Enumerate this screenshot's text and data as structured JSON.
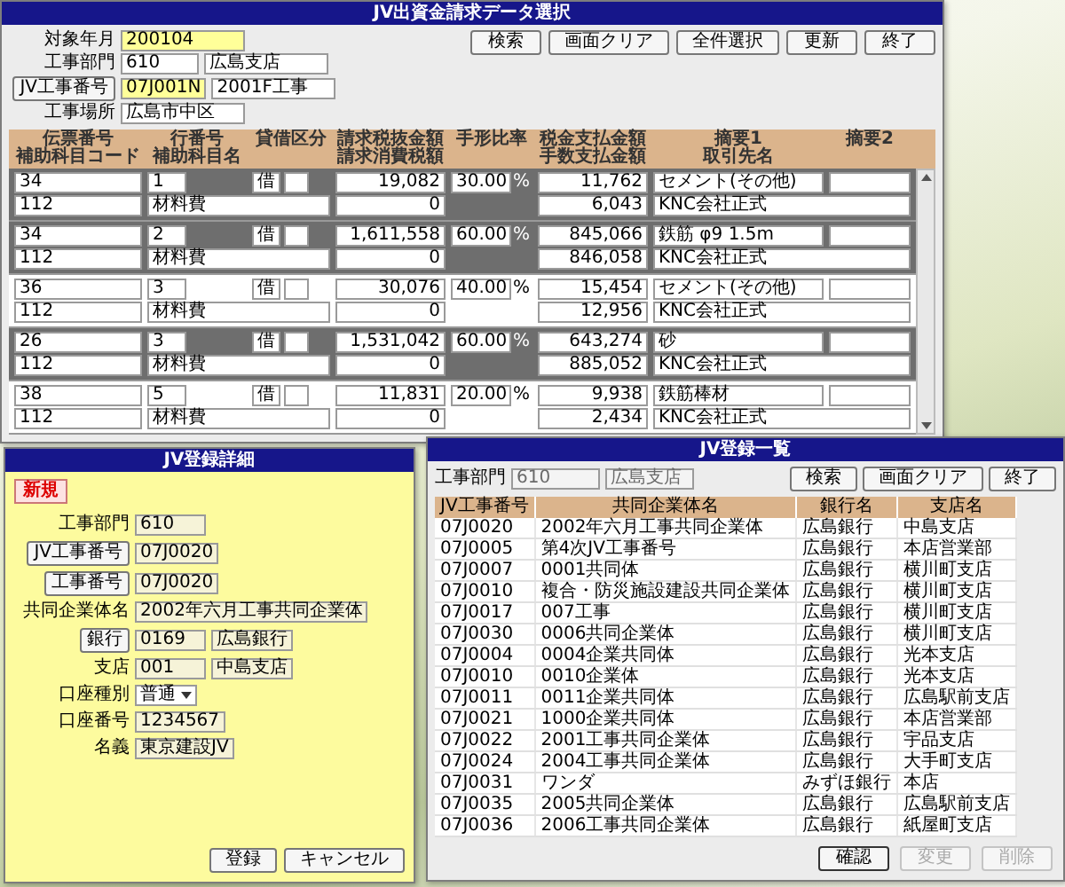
{
  "select_window": {
    "title": "JV出資金請求データ選択",
    "form": [
      {
        "label": "対象年月",
        "kind": "text",
        "fields": [
          {
            "value": "200104",
            "highlighted": true
          }
        ]
      },
      {
        "label": "工事部門",
        "kind": "text",
        "fields": [
          {
            "value": "610",
            "highlighted": false
          },
          {
            "value": "広島支店",
            "highlighted": false
          }
        ]
      },
      {
        "label": "JV工事番号",
        "kind": "button",
        "fields": [
          {
            "value": "07J001N",
            "highlighted": true
          },
          {
            "value": "2001F工事",
            "highlighted": false
          }
        ]
      },
      {
        "label": "工事場所",
        "kind": "text",
        "fields": [
          {
            "value": "広島市中区",
            "highlighted": false
          }
        ]
      }
    ],
    "buttons": [
      "検索",
      "画面クリア",
      "全件選択",
      "更新",
      "終了"
    ],
    "columns": [
      [
        "伝票番号",
        "補助科目コード"
      ],
      [
        "行番号",
        "補助科目名"
      ],
      [
        "貸借区分"
      ],
      [
        "請求税抜金額",
        "請求消費税額"
      ],
      [
        "手形比率"
      ],
      [
        "税金支払金額",
        "手数支払金額"
      ],
      [
        "摘要1",
        "取引先名"
      ],
      [
        "摘要2"
      ]
    ],
    "records": [
      {
        "selected": true,
        "slip": "34",
        "line": "1",
        "dc": "借",
        "amount": "19,082",
        "ratio": "30.00",
        "unit": "%",
        "payment": "11,762",
        "memo_1": "セメント(その他)",
        "sub_code": "112",
        "sub_name": "材料費",
        "tax": "0",
        "fee": "6,043",
        "partner": "KNC会社正式"
      },
      {
        "selected": true,
        "slip": "34",
        "line": "2",
        "dc": "借",
        "amount": "1,611,558",
        "ratio": "60.00",
        "unit": "%",
        "payment": "845,066",
        "memo_1": "鉄筋 φ9 1.5m",
        "sub_code": "112",
        "sub_name": "材料費",
        "tax": "0",
        "fee": "846,058",
        "partner": "KNC会社正式"
      },
      {
        "selected": false,
        "slip": "36",
        "line": "3",
        "dc": "借",
        "amount": "30,076",
        "ratio": "40.00",
        "unit": "%",
        "payment": "15,454",
        "memo_1": "セメント(その他)",
        "sub_code": "112",
        "sub_name": "材料費",
        "tax": "0",
        "fee": "12,956",
        "partner": "KNC会社正式"
      },
      {
        "selected": true,
        "slip": "26",
        "line": "3",
        "dc": "借",
        "amount": "1,531,042",
        "ratio": "60.00",
        "unit": "%",
        "payment": "643,274",
        "memo_1": "砂",
        "sub_code": "112",
        "sub_name": "材料費",
        "tax": "0",
        "fee": "885,052",
        "partner": "KNC会社正式"
      },
      {
        "selected": false,
        "slip": "38",
        "line": "5",
        "dc": "借",
        "amount": "11,831",
        "ratio": "20.00",
        "unit": "%",
        "payment": "9,938",
        "memo_1": "鉄筋棒材",
        "sub_code": "112",
        "sub_name": "材料費",
        "tax": "0",
        "fee": "2,434",
        "partner": "KNC会社正式"
      }
    ]
  },
  "list_window": {
    "title": "JV登録一覧",
    "filter": {
      "label": "工事部門",
      "disabled": true,
      "fields": [
        "610",
        "広島支店"
      ]
    },
    "buttons": [
      "検索",
      "画面クリア",
      "終了"
    ],
    "columns": [
      "JV工事番号",
      "共同企業体名",
      "銀行名",
      "支店名"
    ],
    "rows": [
      {
        "jv_number": "07J0020",
        "name": "2002年六月工事共同企業体",
        "bank": "広島銀行",
        "branch": "中島支店"
      },
      {
        "jv_number": "07J0005",
        "name": "第4次JV工事番号",
        "bank": "広島銀行",
        "branch": "本店営業部"
      },
      {
        "jv_number": "07J0007",
        "name": "0001共同体",
        "bank": "広島銀行",
        "branch": "横川町支店"
      },
      {
        "jv_number": "07J0010",
        "name": "複合・防災施設建設共同企業体",
        "bank": "広島銀行",
        "branch": "横川町支店"
      },
      {
        "jv_number": "07J0017",
        "name": "007工事",
        "bank": "広島銀行",
        "branch": "横川町支店"
      },
      {
        "jv_number": "07J0030",
        "name": "0006共同企業体",
        "bank": "広島銀行",
        "branch": "横川町支店"
      },
      {
        "jv_number": "07J0004",
        "name": "0004企業共同体",
        "bank": "広島銀行",
        "branch": "光本支店"
      },
      {
        "jv_number": "07J0010",
        "name": "0010企業体",
        "bank": "広島銀行",
        "branch": "光本支店"
      },
      {
        "jv_number": "07J0011",
        "name": "0011企業共同体",
        "bank": "広島銀行",
        "branch": "広島駅前支店"
      },
      {
        "jv_number": "07J0021",
        "name": "1000企業共同体",
        "bank": "広島銀行",
        "branch": "本店営業部"
      },
      {
        "jv_number": "07J0022",
        "name": "2001工事共同企業体",
        "bank": "広島銀行",
        "branch": "宇品支店"
      },
      {
        "jv_number": "07J0024",
        "name": "2004工事共同企業体",
        "bank": "広島銀行",
        "branch": "大手町支店"
      },
      {
        "jv_number": "07J0031",
        "name": "ワンダ",
        "bank": "みずほ銀行",
        "branch": "本店"
      },
      {
        "jv_number": "07J0035",
        "name": "2005共同企業体",
        "bank": "広島銀行",
        "branch": "広島駅前支店"
      },
      {
        "jv_number": "07J0036",
        "name": "2006工事共同企業体",
        "bank": "広島銀行",
        "branch": "紙屋町支店"
      }
    ],
    "footer_buttons": [
      {
        "label": "確認",
        "disabled": false
      },
      {
        "label": "変更",
        "disabled": true
      },
      {
        "label": "削除",
        "disabled": true
      }
    ]
  },
  "detail_window": {
    "title": "JV登録詳細",
    "mode_badge": "新規",
    "rows": [
      {
        "label": "工事部門",
        "kind": "text",
        "fields": [
          "610"
        ]
      },
      {
        "label": "JV工事番号",
        "kind": "button",
        "fields": [
          "07J0020"
        ]
      },
      {
        "label": "工事番号",
        "kind": "button",
        "fields": [
          "07J0020"
        ]
      },
      {
        "label": "共同企業体名",
        "kind": "text",
        "fields": [
          "2002年六月工事共同企業体"
        ]
      },
      {
        "label": "銀行",
        "kind": "button",
        "fields": [
          "0169",
          "広島銀行"
        ]
      },
      {
        "label": "支店",
        "kind": "text",
        "fields": [
          "001",
          "中島支店"
        ]
      },
      {
        "label": "口座種別",
        "kind": "select",
        "fields": [
          "普通"
        ]
      },
      {
        "label": "口座番号",
        "kind": "text",
        "fields": [
          "1234567"
        ]
      },
      {
        "label": "名義",
        "kind": "text",
        "fields": [
          "東京建設JV"
        ]
      }
    ],
    "buttons": [
      "登録",
      "キャンセル"
    ]
  }
}
